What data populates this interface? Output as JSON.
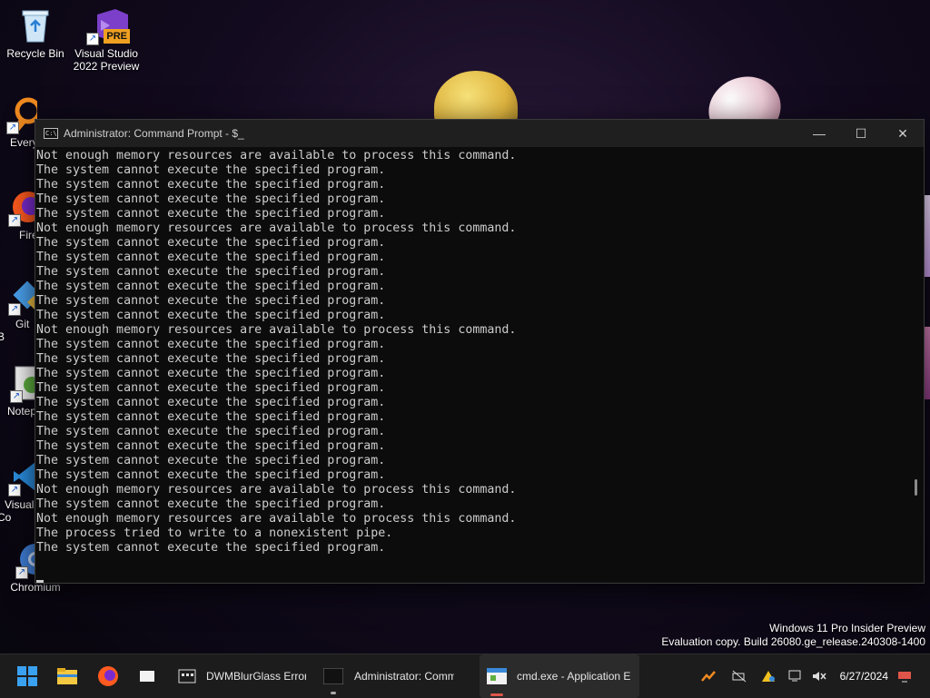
{
  "desktop": {
    "icons": [
      {
        "label": "Recycle Bin"
      },
      {
        "label": "Visual Studio 2022 Preview",
        "badge": "PRE"
      },
      {
        "label": "Every"
      },
      {
        "label": "Fire"
      },
      {
        "label": "Git B"
      },
      {
        "label": "Notep"
      },
      {
        "label": "Visual Co"
      },
      {
        "label": "Chromium"
      }
    ]
  },
  "window": {
    "title": "Administrator: Command Prompt - $_",
    "icon_text": "C:\\",
    "minimize": "—",
    "maximize": "☐",
    "close": "✕"
  },
  "console": {
    "lines": [
      "Not enough memory resources are available to process this command.",
      "The system cannot execute the specified program.",
      "The system cannot execute the specified program.",
      "The system cannot execute the specified program.",
      "The system cannot execute the specified program.",
      "Not enough memory resources are available to process this command.",
      "The system cannot execute the specified program.",
      "The system cannot execute the specified program.",
      "The system cannot execute the specified program.",
      "The system cannot execute the specified program.",
      "The system cannot execute the specified program.",
      "The system cannot execute the specified program.",
      "Not enough memory resources are available to process this command.",
      "The system cannot execute the specified program.",
      "The system cannot execute the specified program.",
      "The system cannot execute the specified program.",
      "The system cannot execute the specified program.",
      "The system cannot execute the specified program.",
      "The system cannot execute the specified program.",
      "The system cannot execute the specified program.",
      "The system cannot execute the specified program.",
      "The system cannot execute the specified program.",
      "The system cannot execute the specified program.",
      "Not enough memory resources are available to process this command.",
      "The system cannot execute the specified program.",
      "Not enough memory resources are available to process this command.",
      "The process tried to write to a nonexistent pipe.",
      "The system cannot execute the specified program."
    ]
  },
  "watermark": {
    "line1": "Windows 11 Pro Insider Preview",
    "line2": "Evaluation copy. Build 26080.ge_release.240308-1400"
  },
  "taskbar": {
    "apps": [
      {
        "label": "DWMBlurGlass Error"
      },
      {
        "label": "Administrator: Comman"
      },
      {
        "label": "cmd.exe - Application E"
      }
    ],
    "date": "6/27/2024"
  },
  "colors": {
    "console_bg": "#0c0c0c",
    "console_text": "#cccccc",
    "taskbar_bg": "#1c1c1c",
    "accent_red": "#e0554a"
  }
}
